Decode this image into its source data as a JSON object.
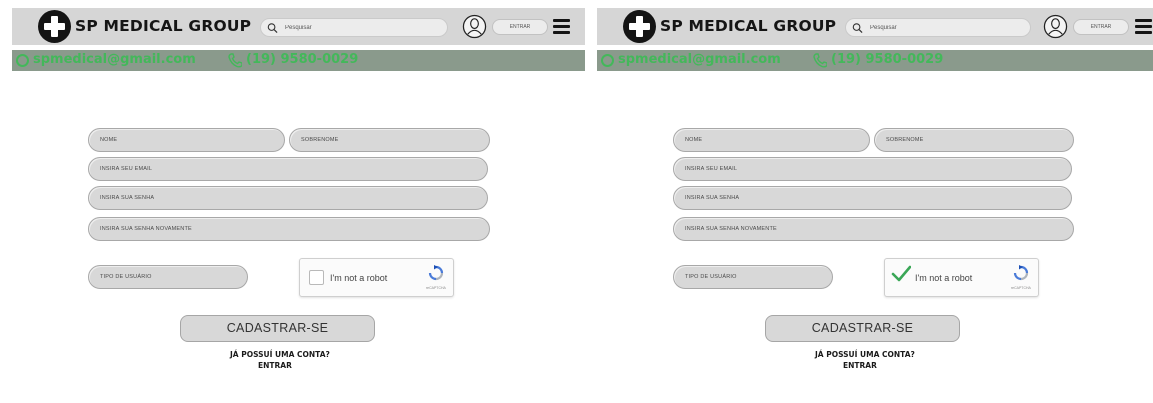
{
  "header": {
    "brand": "SP MEDICAL GROUP",
    "search_placeholder": "Pesquisar",
    "enter_button": "ENTRAR"
  },
  "contact": {
    "email": "spmedical@gmail.com",
    "phone": "(19) 9580-0029"
  },
  "form": {
    "first_name": "NOME",
    "last_name": "SOBRENOME",
    "email": "INSIRA SEU EMAIL",
    "password": "INSIRA SUA SENHA",
    "password_confirm": "INSIRA SUA SENHA NOVAMENTE",
    "user_type": "TIPO DE USUÁRIO",
    "captcha_label": "I'm not a robot",
    "captcha_brand": "reCAPTCHA",
    "submit": "CADASTRAR-SE",
    "have_account": "JÁ POSSUÍ UMA CONTA?",
    "login_link": "ENTRAR"
  },
  "panels": [
    {
      "captcha_checked": false
    },
    {
      "captcha_checked": true
    }
  ],
  "colors": {
    "topbar": "#d6d6d6",
    "contactbar": "#8a9a8c",
    "accent_green": "#43b85a",
    "field_fill": "#d8d8d8"
  }
}
